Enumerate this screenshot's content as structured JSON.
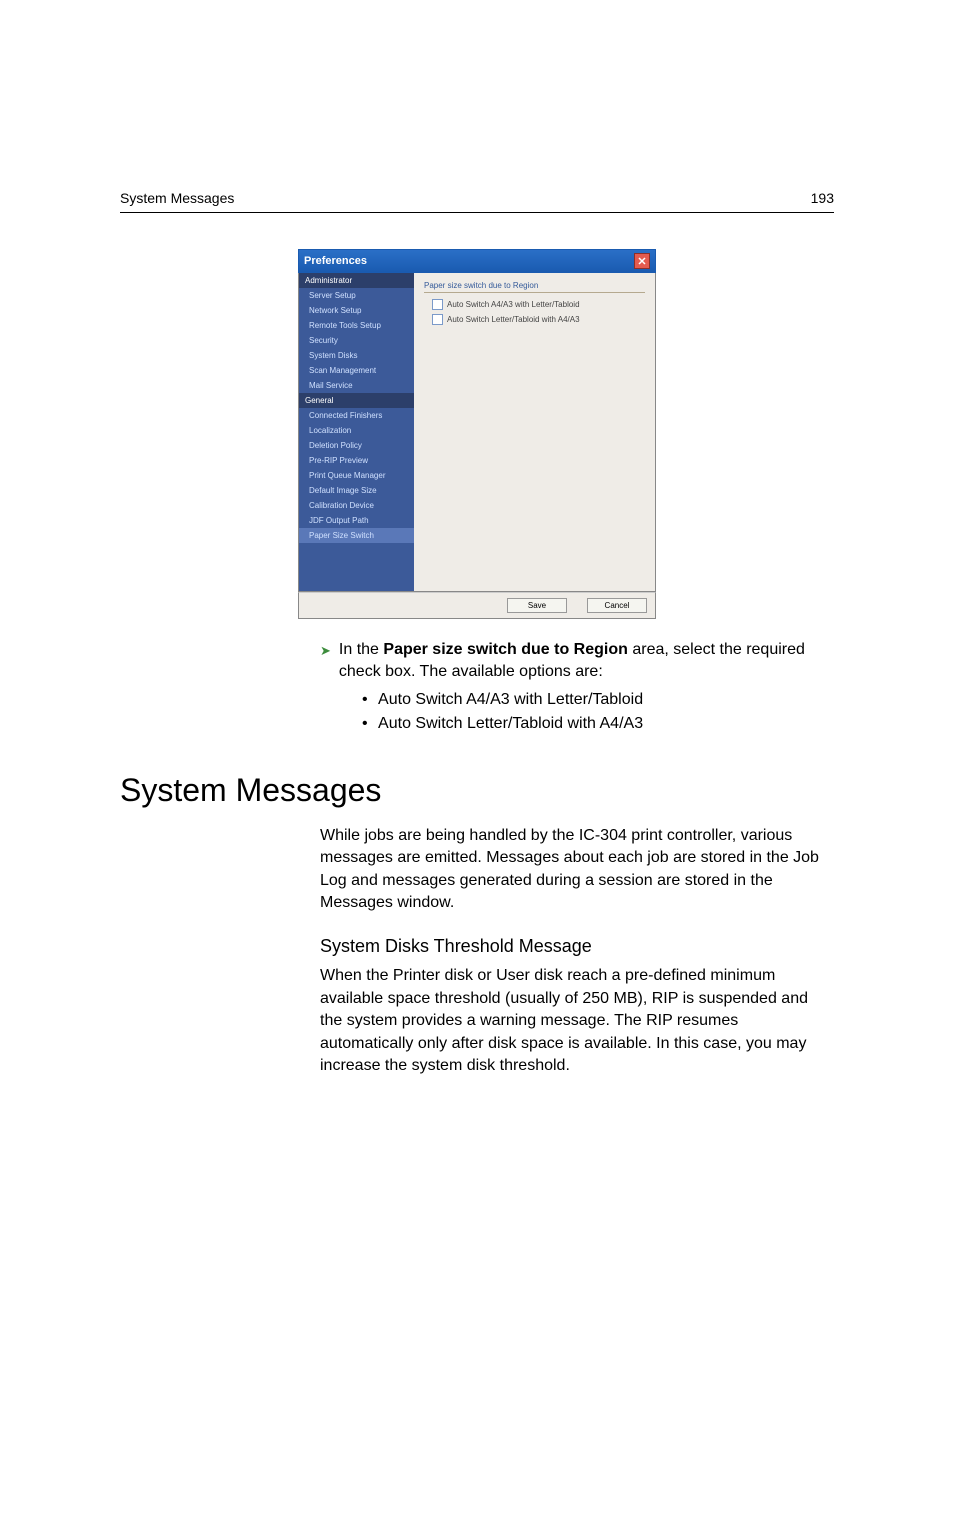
{
  "header": {
    "left": "System Messages",
    "right": "193"
  },
  "dialog": {
    "title": "Preferences",
    "sidebar": {
      "groups": [
        {
          "title": "Administrator",
          "items": [
            "Server Setup",
            "Network Setup",
            "Remote Tools Setup",
            "Security",
            "System Disks",
            "Scan Management",
            "Mail Service"
          ]
        },
        {
          "title": "General",
          "items": [
            "Connected Finishers",
            "Localization",
            "Deletion Policy",
            "Pre-RIP Preview",
            "Print Queue Manager",
            "Default Image Size",
            "Calibration Device",
            "JDF Output Path",
            "Paper Size Switch"
          ]
        }
      ]
    },
    "main": {
      "group": "Paper size switch due to Region",
      "options": [
        "Auto Switch A4/A3 with Letter/Tabloid",
        "Auto Switch Letter/Tabloid with A4/A3"
      ]
    },
    "buttons": {
      "save": "Save",
      "cancel": "Cancel"
    }
  },
  "body": {
    "instruction": {
      "pre": "In the ",
      "bold": "Paper size switch due to Region",
      "post": " area, select the required check box. The available options are:"
    },
    "bullets": [
      "Auto Switch A4/A3 with Letter/Tabloid",
      "Auto Switch Letter/Tabloid with A4/A3"
    ],
    "section_heading": "System Messages",
    "section_p1": "While jobs are being handled by the IC-304 print controller, various messages are emitted. Messages about each job are stored in the Job Log and messages generated during a session are stored in the Messages window.",
    "subheading": "System Disks Threshold Message",
    "section_p2": "When the Printer disk or User disk reach a pre-defined minimum available space threshold (usually of 250 MB), RIP is suspended and the system provides a warning message. The RIP resumes automatically only after disk space is available. In this case, you may increase the system disk threshold."
  }
}
